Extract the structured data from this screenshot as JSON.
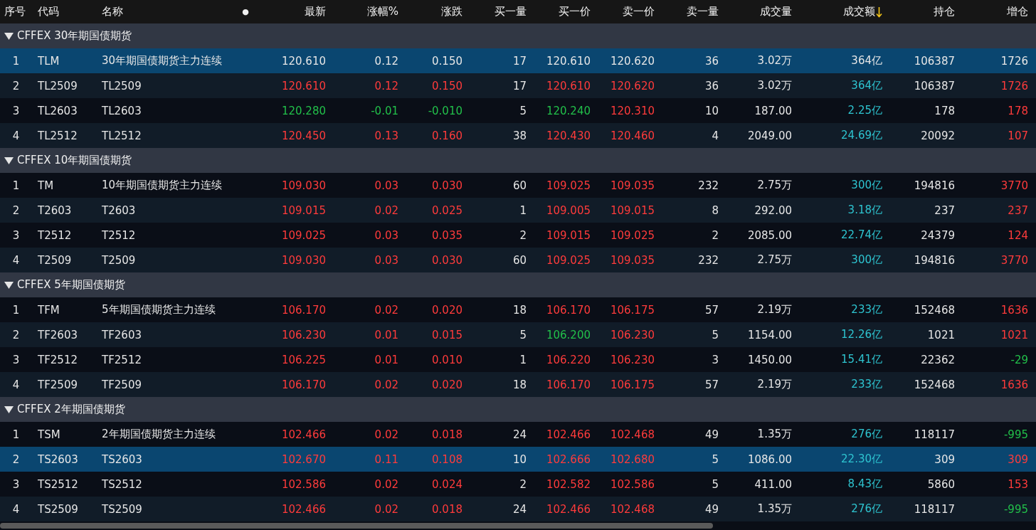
{
  "columns": [
    {
      "label": "序号",
      "sorted": false
    },
    {
      "label": "代码",
      "sorted": false
    },
    {
      "label": "名称",
      "sorted": false
    },
    {
      "label": "●",
      "sorted": false
    },
    {
      "label": "最新",
      "sorted": false
    },
    {
      "label": "涨幅%",
      "sorted": false
    },
    {
      "label": "涨跌",
      "sorted": false
    },
    {
      "label": "买一量",
      "sorted": false
    },
    {
      "label": "买一价",
      "sorted": false
    },
    {
      "label": "卖一价",
      "sorted": false
    },
    {
      "label": "卖一量",
      "sorted": false
    },
    {
      "label": "成交量",
      "sorted": false
    },
    {
      "label": "成交额",
      "sorted": true
    },
    {
      "label": "持仓",
      "sorted": false
    },
    {
      "label": "增仓",
      "sorted": false
    }
  ],
  "groups": [
    {
      "title": "CFFEX 30年期国债期货",
      "expanded": true,
      "rows": [
        {
          "no": "1",
          "code": "TLM",
          "name": "30年期国债期货主力连续",
          "selected": true,
          "values": [
            {
              "text": "120.610",
              "color": "#e6e6e6"
            },
            {
              "text": "0.12",
              "color": "#e6e6e6"
            },
            {
              "text": "0.150",
              "color": "#e6e6e6"
            },
            {
              "text": "17",
              "color": "#e6e6e6"
            },
            {
              "text": "120.610",
              "color": "#e6e6e6"
            },
            {
              "text": "120.620",
              "color": "#e6e6e6"
            },
            {
              "text": "36",
              "color": "#e6e6e6"
            },
            {
              "text": "3.02万",
              "color": "#e6e6e6"
            },
            {
              "text": "364亿",
              "color": "#e6e6e6"
            },
            {
              "text": "106387",
              "color": "#e6e6e6"
            },
            {
              "text": "1726",
              "color": "#e6e6e6"
            }
          ]
        },
        {
          "no": "2",
          "code": "TL2509",
          "name": "TL2509",
          "selected": false,
          "values": [
            {
              "text": "120.610",
              "color": "#ff3b3b"
            },
            {
              "text": "0.12",
              "color": "#ff3b3b"
            },
            {
              "text": "0.150",
              "color": "#ff3b3b"
            },
            {
              "text": "17",
              "color": "#e6e6e6"
            },
            {
              "text": "120.610",
              "color": "#ff3b3b"
            },
            {
              "text": "120.620",
              "color": "#ff3b3b"
            },
            {
              "text": "36",
              "color": "#e6e6e6"
            },
            {
              "text": "3.02万",
              "color": "#e6e6e6"
            },
            {
              "text": "364亿",
              "color": "#2ec4d0"
            },
            {
              "text": "106387",
              "color": "#e6e6e6"
            },
            {
              "text": "1726",
              "color": "#ff3b3b"
            }
          ]
        },
        {
          "no": "3",
          "code": "TL2603",
          "name": "TL2603",
          "selected": false,
          "values": [
            {
              "text": "120.280",
              "color": "#22c04a"
            },
            {
              "text": "-0.01",
              "color": "#22c04a"
            },
            {
              "text": "-0.010",
              "color": "#22c04a"
            },
            {
              "text": "5",
              "color": "#e6e6e6"
            },
            {
              "text": "120.240",
              "color": "#22c04a"
            },
            {
              "text": "120.310",
              "color": "#ff3b3b"
            },
            {
              "text": "10",
              "color": "#e6e6e6"
            },
            {
              "text": "187.00",
              "color": "#e6e6e6"
            },
            {
              "text": "2.25亿",
              "color": "#2ec4d0"
            },
            {
              "text": "178",
              "color": "#e6e6e6"
            },
            {
              "text": "178",
              "color": "#ff3b3b"
            }
          ]
        },
        {
          "no": "4",
          "code": "TL2512",
          "name": "TL2512",
          "selected": false,
          "values": [
            {
              "text": "120.450",
              "color": "#ff3b3b"
            },
            {
              "text": "0.13",
              "color": "#ff3b3b"
            },
            {
              "text": "0.160",
              "color": "#ff3b3b"
            },
            {
              "text": "38",
              "color": "#e6e6e6"
            },
            {
              "text": "120.430",
              "color": "#ff3b3b"
            },
            {
              "text": "120.460",
              "color": "#ff3b3b"
            },
            {
              "text": "4",
              "color": "#e6e6e6"
            },
            {
              "text": "2049.00",
              "color": "#e6e6e6"
            },
            {
              "text": "24.69亿",
              "color": "#2ec4d0"
            },
            {
              "text": "20092",
              "color": "#e6e6e6"
            },
            {
              "text": "107",
              "color": "#ff3b3b"
            }
          ]
        }
      ]
    },
    {
      "title": "CFFEX 10年期国债期货",
      "expanded": true,
      "rows": [
        {
          "no": "1",
          "code": "TM",
          "name": "10年期国债期货主力连续",
          "selected": false,
          "values": [
            {
              "text": "109.030",
              "color": "#ff3b3b"
            },
            {
              "text": "0.03",
              "color": "#ff3b3b"
            },
            {
              "text": "0.030",
              "color": "#ff3b3b"
            },
            {
              "text": "60",
              "color": "#e6e6e6"
            },
            {
              "text": "109.025",
              "color": "#ff3b3b"
            },
            {
              "text": "109.035",
              "color": "#ff3b3b"
            },
            {
              "text": "232",
              "color": "#e6e6e6"
            },
            {
              "text": "2.75万",
              "color": "#e6e6e6"
            },
            {
              "text": "300亿",
              "color": "#2ec4d0"
            },
            {
              "text": "194816",
              "color": "#e6e6e6"
            },
            {
              "text": "3770",
              "color": "#ff3b3b"
            }
          ]
        },
        {
          "no": "2",
          "code": "T2603",
          "name": "T2603",
          "selected": false,
          "values": [
            {
              "text": "109.015",
              "color": "#ff3b3b"
            },
            {
              "text": "0.02",
              "color": "#ff3b3b"
            },
            {
              "text": "0.025",
              "color": "#ff3b3b"
            },
            {
              "text": "1",
              "color": "#e6e6e6"
            },
            {
              "text": "109.005",
              "color": "#ff3b3b"
            },
            {
              "text": "109.015",
              "color": "#ff3b3b"
            },
            {
              "text": "8",
              "color": "#e6e6e6"
            },
            {
              "text": "292.00",
              "color": "#e6e6e6"
            },
            {
              "text": "3.18亿",
              "color": "#2ec4d0"
            },
            {
              "text": "237",
              "color": "#e6e6e6"
            },
            {
              "text": "237",
              "color": "#ff3b3b"
            }
          ]
        },
        {
          "no": "3",
          "code": "T2512",
          "name": "T2512",
          "selected": false,
          "values": [
            {
              "text": "109.025",
              "color": "#ff3b3b"
            },
            {
              "text": "0.03",
              "color": "#ff3b3b"
            },
            {
              "text": "0.035",
              "color": "#ff3b3b"
            },
            {
              "text": "2",
              "color": "#e6e6e6"
            },
            {
              "text": "109.015",
              "color": "#ff3b3b"
            },
            {
              "text": "109.025",
              "color": "#ff3b3b"
            },
            {
              "text": "2",
              "color": "#e6e6e6"
            },
            {
              "text": "2085.00",
              "color": "#e6e6e6"
            },
            {
              "text": "22.74亿",
              "color": "#2ec4d0"
            },
            {
              "text": "24379",
              "color": "#e6e6e6"
            },
            {
              "text": "124",
              "color": "#ff3b3b"
            }
          ]
        },
        {
          "no": "4",
          "code": "T2509",
          "name": "T2509",
          "selected": false,
          "values": [
            {
              "text": "109.030",
              "color": "#ff3b3b"
            },
            {
              "text": "0.03",
              "color": "#ff3b3b"
            },
            {
              "text": "0.030",
              "color": "#ff3b3b"
            },
            {
              "text": "60",
              "color": "#e6e6e6"
            },
            {
              "text": "109.025",
              "color": "#ff3b3b"
            },
            {
              "text": "109.035",
              "color": "#ff3b3b"
            },
            {
              "text": "232",
              "color": "#e6e6e6"
            },
            {
              "text": "2.75万",
              "color": "#e6e6e6"
            },
            {
              "text": "300亿",
              "color": "#2ec4d0"
            },
            {
              "text": "194816",
              "color": "#e6e6e6"
            },
            {
              "text": "3770",
              "color": "#ff3b3b"
            }
          ]
        }
      ]
    },
    {
      "title": "CFFEX 5年期国债期货",
      "expanded": true,
      "rows": [
        {
          "no": "1",
          "code": "TFM",
          "name": "5年期国债期货主力连续",
          "selected": false,
          "values": [
            {
              "text": "106.170",
              "color": "#ff3b3b"
            },
            {
              "text": "0.02",
              "color": "#ff3b3b"
            },
            {
              "text": "0.020",
              "color": "#ff3b3b"
            },
            {
              "text": "18",
              "color": "#e6e6e6"
            },
            {
              "text": "106.170",
              "color": "#ff3b3b"
            },
            {
              "text": "106.175",
              "color": "#ff3b3b"
            },
            {
              "text": "57",
              "color": "#e6e6e6"
            },
            {
              "text": "2.19万",
              "color": "#e6e6e6"
            },
            {
              "text": "233亿",
              "color": "#2ec4d0"
            },
            {
              "text": "152468",
              "color": "#e6e6e6"
            },
            {
              "text": "1636",
              "color": "#ff3b3b"
            }
          ]
        },
        {
          "no": "2",
          "code": "TF2603",
          "name": "TF2603",
          "selected": false,
          "values": [
            {
              "text": "106.230",
              "color": "#ff3b3b"
            },
            {
              "text": "0.01",
              "color": "#ff3b3b"
            },
            {
              "text": "0.015",
              "color": "#ff3b3b"
            },
            {
              "text": "5",
              "color": "#e6e6e6"
            },
            {
              "text": "106.200",
              "color": "#22c04a"
            },
            {
              "text": "106.230",
              "color": "#ff3b3b"
            },
            {
              "text": "5",
              "color": "#e6e6e6"
            },
            {
              "text": "1154.00",
              "color": "#e6e6e6"
            },
            {
              "text": "12.26亿",
              "color": "#2ec4d0"
            },
            {
              "text": "1021",
              "color": "#e6e6e6"
            },
            {
              "text": "1021",
              "color": "#ff3b3b"
            }
          ]
        },
        {
          "no": "3",
          "code": "TF2512",
          "name": "TF2512",
          "selected": false,
          "values": [
            {
              "text": "106.225",
              "color": "#ff3b3b"
            },
            {
              "text": "0.01",
              "color": "#ff3b3b"
            },
            {
              "text": "0.010",
              "color": "#ff3b3b"
            },
            {
              "text": "1",
              "color": "#e6e6e6"
            },
            {
              "text": "106.220",
              "color": "#ff3b3b"
            },
            {
              "text": "106.230",
              "color": "#ff3b3b"
            },
            {
              "text": "3",
              "color": "#e6e6e6"
            },
            {
              "text": "1450.00",
              "color": "#e6e6e6"
            },
            {
              "text": "15.41亿",
              "color": "#2ec4d0"
            },
            {
              "text": "22362",
              "color": "#e6e6e6"
            },
            {
              "text": "-29",
              "color": "#22c04a"
            }
          ]
        },
        {
          "no": "4",
          "code": "TF2509",
          "name": "TF2509",
          "selected": false,
          "values": [
            {
              "text": "106.170",
              "color": "#ff3b3b"
            },
            {
              "text": "0.02",
              "color": "#ff3b3b"
            },
            {
              "text": "0.020",
              "color": "#ff3b3b"
            },
            {
              "text": "18",
              "color": "#e6e6e6"
            },
            {
              "text": "106.170",
              "color": "#ff3b3b"
            },
            {
              "text": "106.175",
              "color": "#ff3b3b"
            },
            {
              "text": "57",
              "color": "#e6e6e6"
            },
            {
              "text": "2.19万",
              "color": "#e6e6e6"
            },
            {
              "text": "233亿",
              "color": "#2ec4d0"
            },
            {
              "text": "152468",
              "color": "#e6e6e6"
            },
            {
              "text": "1636",
              "color": "#ff3b3b"
            }
          ]
        }
      ]
    },
    {
      "title": "CFFEX 2年期国债期货",
      "expanded": true,
      "rows": [
        {
          "no": "1",
          "code": "TSM",
          "name": "2年期国债期货主力连续",
          "selected": false,
          "values": [
            {
              "text": "102.466",
              "color": "#ff3b3b"
            },
            {
              "text": "0.02",
              "color": "#ff3b3b"
            },
            {
              "text": "0.018",
              "color": "#ff3b3b"
            },
            {
              "text": "24",
              "color": "#e6e6e6"
            },
            {
              "text": "102.466",
              "color": "#ff3b3b"
            },
            {
              "text": "102.468",
              "color": "#ff3b3b"
            },
            {
              "text": "49",
              "color": "#e6e6e6"
            },
            {
              "text": "1.35万",
              "color": "#e6e6e6"
            },
            {
              "text": "276亿",
              "color": "#2ec4d0"
            },
            {
              "text": "118117",
              "color": "#e6e6e6"
            },
            {
              "text": "-995",
              "color": "#22c04a"
            }
          ]
        },
        {
          "no": "2",
          "code": "TS2603",
          "name": "TS2603",
          "selected": true,
          "values": [
            {
              "text": "102.670",
              "color": "#ff3b3b"
            },
            {
              "text": "0.11",
              "color": "#ff3b3b"
            },
            {
              "text": "0.108",
              "color": "#ff3b3b"
            },
            {
              "text": "10",
              "color": "#e6e6e6"
            },
            {
              "text": "102.666",
              "color": "#ff3b3b"
            },
            {
              "text": "102.680",
              "color": "#ff3b3b"
            },
            {
              "text": "5",
              "color": "#e6e6e6"
            },
            {
              "text": "1086.00",
              "color": "#e6e6e6"
            },
            {
              "text": "22.30亿",
              "color": "#2ec4d0"
            },
            {
              "text": "309",
              "color": "#e6e6e6"
            },
            {
              "text": "309",
              "color": "#ff3b3b"
            }
          ]
        },
        {
          "no": "3",
          "code": "TS2512",
          "name": "TS2512",
          "selected": false,
          "values": [
            {
              "text": "102.586",
              "color": "#ff3b3b"
            },
            {
              "text": "0.02",
              "color": "#ff3b3b"
            },
            {
              "text": "0.024",
              "color": "#ff3b3b"
            },
            {
              "text": "2",
              "color": "#e6e6e6"
            },
            {
              "text": "102.582",
              "color": "#ff3b3b"
            },
            {
              "text": "102.586",
              "color": "#ff3b3b"
            },
            {
              "text": "5",
              "color": "#e6e6e6"
            },
            {
              "text": "411.00",
              "color": "#e6e6e6"
            },
            {
              "text": "8.43亿",
              "color": "#2ec4d0"
            },
            {
              "text": "5860",
              "color": "#e6e6e6"
            },
            {
              "text": "153",
              "color": "#ff3b3b"
            }
          ]
        },
        {
          "no": "4",
          "code": "TS2509",
          "name": "TS2509",
          "selected": false,
          "values": [
            {
              "text": "102.466",
              "color": "#ff3b3b"
            },
            {
              "text": "0.02",
              "color": "#ff3b3b"
            },
            {
              "text": "0.018",
              "color": "#ff3b3b"
            },
            {
              "text": "24",
              "color": "#e6e6e6"
            },
            {
              "text": "102.466",
              "color": "#ff3b3b"
            },
            {
              "text": "102.468",
              "color": "#ff3b3b"
            },
            {
              "text": "49",
              "color": "#e6e6e6"
            },
            {
              "text": "1.35万",
              "color": "#e6e6e6"
            },
            {
              "text": "276亿",
              "color": "#2ec4d0"
            },
            {
              "text": "118117",
              "color": "#e6e6e6"
            },
            {
              "text": "-995",
              "color": "#22c04a"
            }
          ]
        }
      ]
    }
  ]
}
